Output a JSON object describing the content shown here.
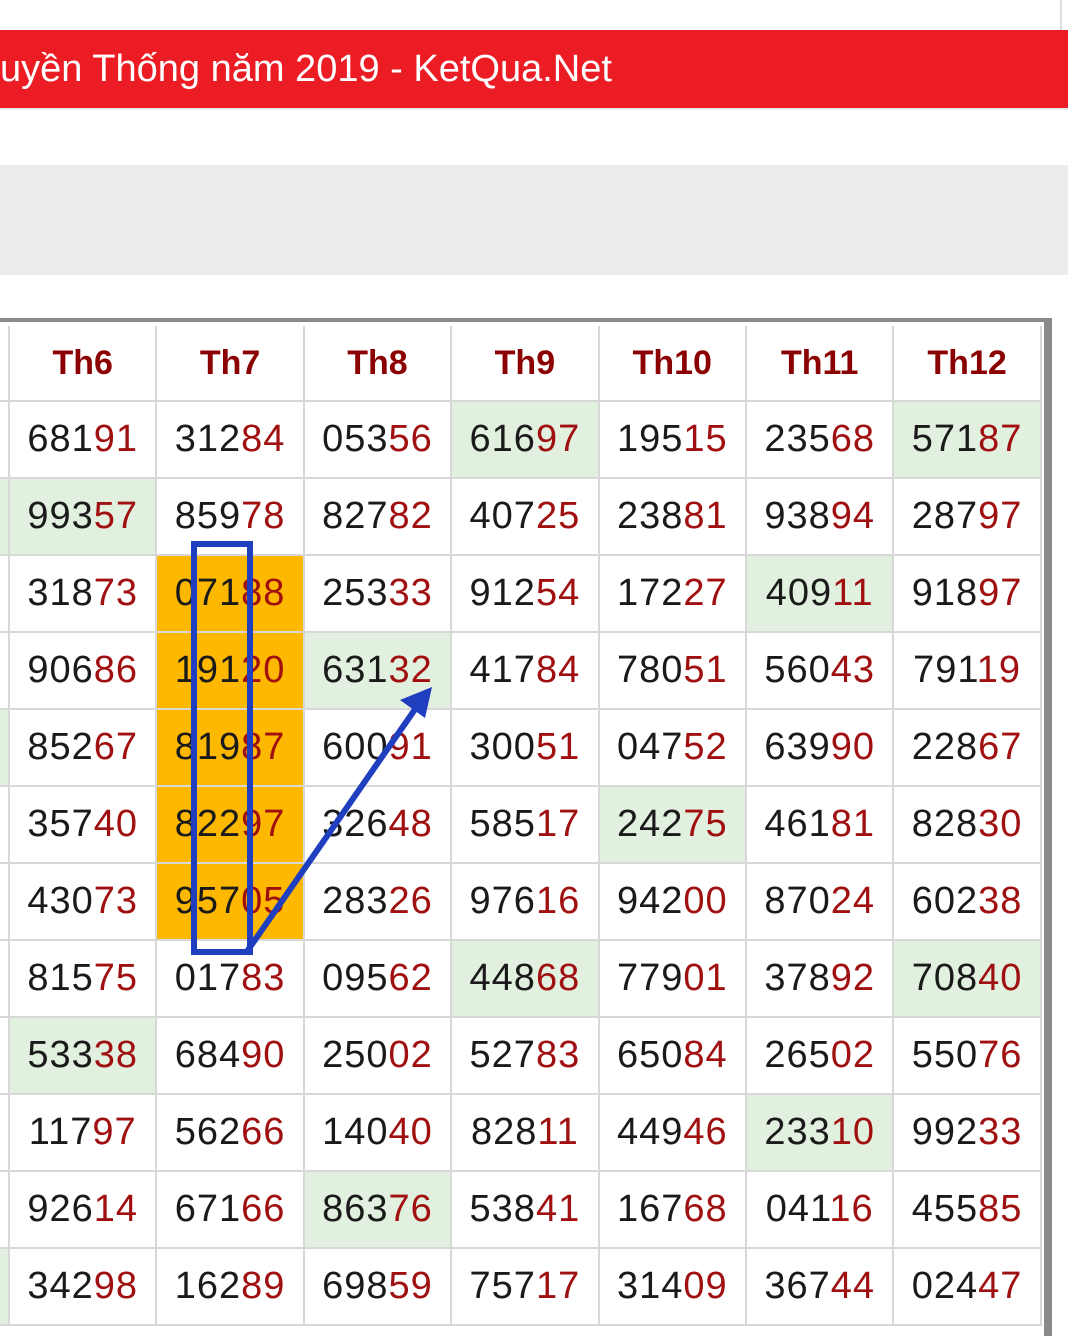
{
  "header": {
    "title": "uyền Thống năm 2019 - KetQua.Net",
    "background": "#ec1c24"
  },
  "table": {
    "columns": [
      "Th6",
      "Th7",
      "Th8",
      "Th9",
      "Th10",
      "Th11",
      "Th12"
    ],
    "rows": [
      [
        "68191",
        "31284",
        "05356",
        "61697",
        "19515",
        "23568",
        "57187"
      ],
      [
        "99357",
        "85978",
        "82782",
        "40725",
        "23881",
        "93894",
        "28797"
      ],
      [
        "31873",
        "07188",
        "25333",
        "91254",
        "17227",
        "40911",
        "91897"
      ],
      [
        "90686",
        "19120",
        "63132",
        "41784",
        "78051",
        "56043",
        "79119"
      ],
      [
        "85267",
        "81987",
        "60091",
        "30051",
        "04752",
        "63990",
        "22867"
      ],
      [
        "35740",
        "82297",
        "32648",
        "58517",
        "24275",
        "46181",
        "82830"
      ],
      [
        "43073",
        "95705",
        "28326",
        "97616",
        "94200",
        "87024",
        "60238"
      ],
      [
        "81575",
        "01783",
        "09562",
        "44868",
        "77901",
        "37892",
        "70840"
      ],
      [
        "53338",
        "68490",
        "25002",
        "52783",
        "65084",
        "26502",
        "55076"
      ],
      [
        "11797",
        "56266",
        "14040",
        "82811",
        "44946",
        "23310",
        "99233"
      ],
      [
        "92614",
        "67166",
        "86376",
        "53841",
        "16768",
        "04116",
        "45585"
      ],
      [
        "34298",
        "16289",
        "69859",
        "75717",
        "31409",
        "36744",
        "02447"
      ]
    ],
    "highlight": [
      [
        "",
        "",
        "",
        "green",
        "",
        "",
        "green"
      ],
      [
        "green",
        "",
        "",
        "",
        "",
        "",
        ""
      ],
      [
        "",
        "orange",
        "",
        "",
        "",
        "green",
        ""
      ],
      [
        "",
        "orange",
        "green",
        "",
        "",
        "",
        ""
      ],
      [
        "",
        "orange",
        "",
        "",
        "",
        "",
        ""
      ],
      [
        "",
        "orange",
        "",
        "",
        "green",
        "",
        ""
      ],
      [
        "",
        "orange",
        "",
        "",
        "",
        "",
        ""
      ],
      [
        "",
        "",
        "",
        "green",
        "",
        "",
        "green"
      ],
      [
        "green",
        "",
        "",
        "",
        "",
        "",
        ""
      ],
      [
        "",
        "",
        "",
        "",
        "",
        "green",
        ""
      ],
      [
        "",
        "",
        "green",
        "",
        "",
        "",
        ""
      ],
      [
        "",
        "",
        "",
        "",
        "",
        "",
        ""
      ]
    ],
    "left_stub_highlight": [
      "",
      "green",
      "",
      "",
      "green",
      "",
      "",
      "",
      "",
      "",
      "",
      "green"
    ],
    "colors": {
      "header_text": "#8b0000",
      "tail_digits": "#a01010",
      "green_cell": "#e2f0df",
      "orange_cell": "#ffb800",
      "annotation": "#1f3fbf"
    }
  }
}
